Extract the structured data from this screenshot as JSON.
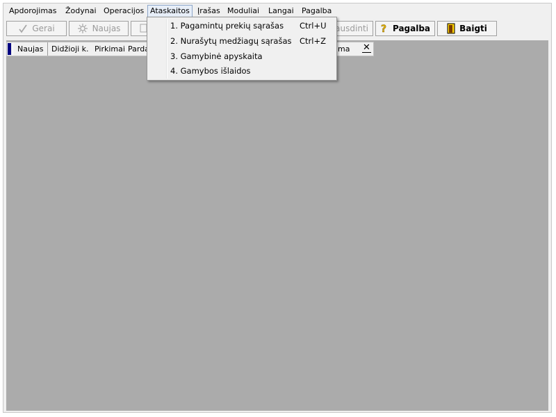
{
  "menubar": {
    "items": [
      {
        "label": "Apdorojimas",
        "active": false
      },
      {
        "label": "Žodynai",
        "active": false
      },
      {
        "label": "Operacijos",
        "active": false
      },
      {
        "label": "Ataskaitos",
        "active": true
      },
      {
        "label": "Įrašas",
        "active": false
      },
      {
        "label": "Moduliai",
        "active": false
      },
      {
        "label": "Langai",
        "active": false
      },
      {
        "label": "Pagalba",
        "active": false
      }
    ]
  },
  "toolbar": {
    "gerai_label": "Gerai",
    "naujas_label": "Naujas",
    "spausdinti_label": "pausdinti",
    "pagalba_label": "Pagalba",
    "baigti_label": "Baigti"
  },
  "tabs": {
    "items": [
      "Naujas",
      "Didžioji k.",
      "Pirkimai",
      "Pardav",
      "ma"
    ],
    "close_glyph": "✕"
  },
  "dropdown": {
    "items": [
      {
        "label": "1. Pagamintų prekių sąrašas",
        "shortcut": "Ctrl+U"
      },
      {
        "label": "2. Nurašytų medžiagų sąrašas",
        "shortcut": "Ctrl+Z"
      },
      {
        "label": "3. Gamybinė apyskaita",
        "shortcut": ""
      },
      {
        "label": "4. Gamybos išlaidos",
        "shortcut": ""
      }
    ]
  },
  "icons": {
    "gerai": "checkmark-icon",
    "naujas": "new-sparkle-icon",
    "spausdinti": "print-icon",
    "pagalba": "question-icon",
    "baigti": "exit-door-icon"
  },
  "colors": {
    "client_bg": "#ababab",
    "menu_active_bg": "#e7eef8",
    "tab_marker": "#000080",
    "help_icon": "#e0b000"
  }
}
